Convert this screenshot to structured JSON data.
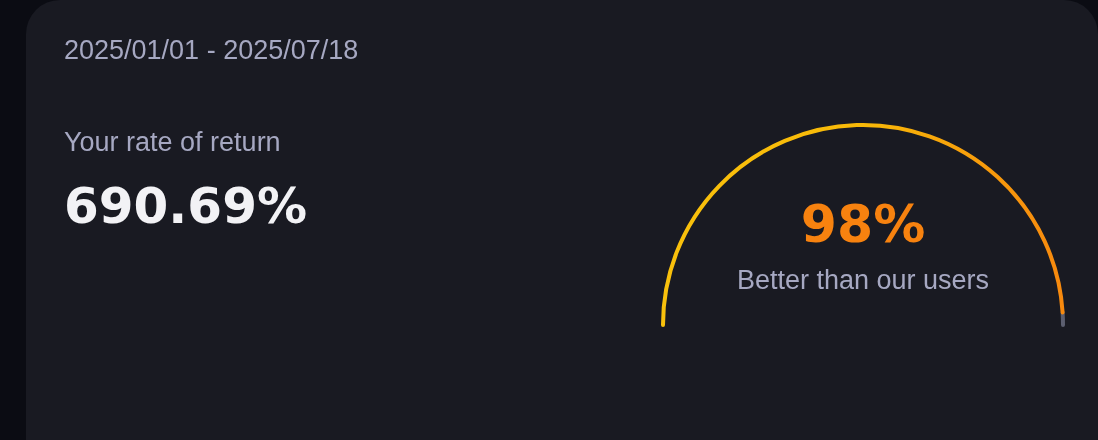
{
  "date_range": "2025/01/01 - 2025/07/18",
  "return": {
    "label": "Your rate of return",
    "value": "690.69%"
  },
  "gauge": {
    "level": 0.98,
    "value": "98%",
    "caption": "Better than our users"
  }
}
